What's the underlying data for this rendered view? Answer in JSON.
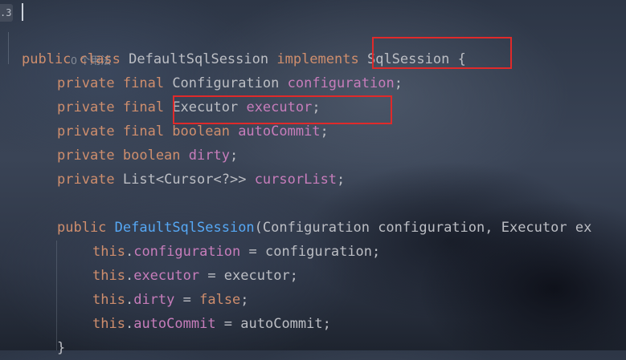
{
  "gutter": {
    "line_number": ".3"
  },
  "code": {
    "usages": "0 个用法",
    "class_decl": {
      "kw_public": "public",
      "kw_class": "class",
      "name": "DefaultSqlSession",
      "kw_implements": "implements",
      "iface": "SqlSession",
      "brace": "{"
    },
    "fields": [
      {
        "mods": "private final",
        "type": "Configuration",
        "name": "configuration",
        "semi": ";"
      },
      {
        "mods": "private final",
        "type": "Executor",
        "name": "executor",
        "semi": ";"
      },
      {
        "mods": "private final boolean",
        "type": "",
        "name": "autoCommit",
        "semi": ";"
      },
      {
        "mods": "private boolean",
        "type": "",
        "name": "dirty",
        "semi": ";"
      },
      {
        "mods": "private",
        "type": "List<Cursor<?>>",
        "name": "cursorList",
        "semi": ";"
      }
    ],
    "constructor": {
      "kw_public": "public",
      "name": "DefaultSqlSession",
      "params": "(Configuration configuration, Executor ex"
    },
    "assignments": [
      {
        "this": "this",
        "field": "configuration",
        "rhs": " = configuration;"
      },
      {
        "this": "this",
        "field": "executor",
        "rhs": " = executor;"
      },
      {
        "this": "this",
        "field": "dirty",
        "eq": " = ",
        "lit": "false",
        "semi": ";"
      },
      {
        "this": "this",
        "field": "autoCommit",
        "rhs": " = autoCommit;"
      }
    ],
    "closing": "}"
  },
  "annotations": {
    "color": "#e02a2a"
  }
}
